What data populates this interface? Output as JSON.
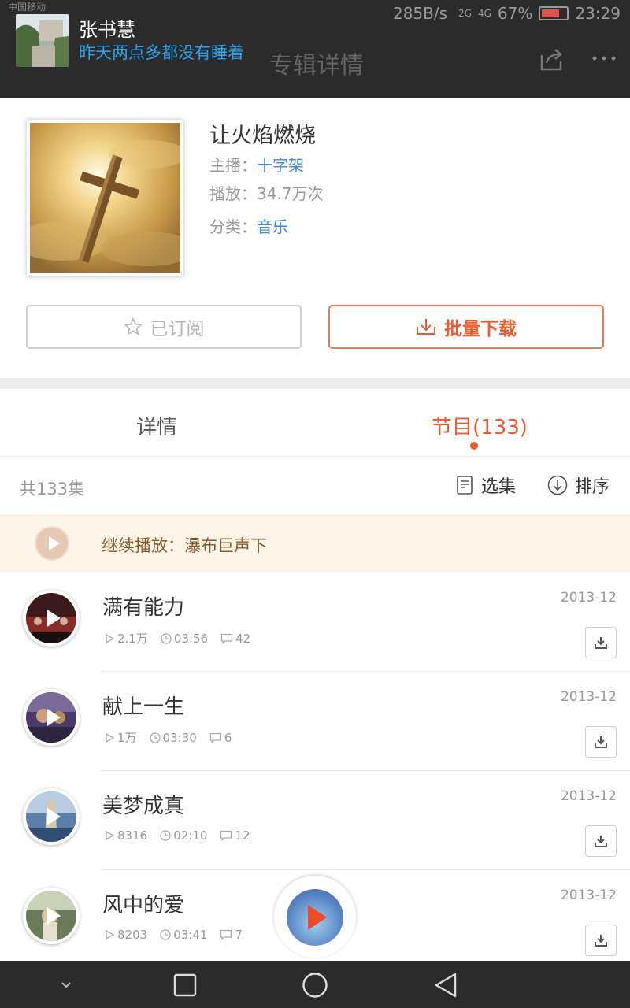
{
  "status_bar": {
    "carrier": "中国移动",
    "speed": "285B/s",
    "network_1": "2G",
    "network_2": "4G",
    "battery": "67%",
    "time": "23:29"
  },
  "header": {
    "title": "专辑详情"
  },
  "notification": {
    "name": "张书慧",
    "message": "昨天两点多都没有睡着"
  },
  "album": {
    "title": "让火焰燃烧",
    "host_label": "主播：",
    "host": "十字架",
    "plays": "播放：34.7万次",
    "category_label": "分类：",
    "category": "音乐",
    "subscribe_label": "已订阅",
    "download_label": "批量下载"
  },
  "tabs": {
    "detail": "详情",
    "programs": "节目(133)"
  },
  "list": {
    "count": "共133集",
    "select_label": "选集",
    "sort_label": "排序"
  },
  "continue_play": {
    "text": "继续播放：瀑布巨声下"
  },
  "tracks": [
    {
      "title": "满有能力",
      "plays": "2.1万",
      "duration": "03:56",
      "comments": "42",
      "date": "2013-12"
    },
    {
      "title": "献上一生",
      "plays": "1万",
      "duration": "03:30",
      "comments": "6",
      "date": "2013-12"
    },
    {
      "title": "美梦成真",
      "plays": "8316",
      "duration": "02:10",
      "comments": "12",
      "date": "2013-12"
    },
    {
      "title": "风中的爱",
      "plays": "8203",
      "duration": "03:41",
      "comments": "7",
      "date": "2013-12"
    }
  ],
  "colors": {
    "accent": "#ef5a2d",
    "link": "#3f8ad4",
    "notification_msg": "#29a3ef",
    "dark_bar": "#2b2b2b"
  }
}
